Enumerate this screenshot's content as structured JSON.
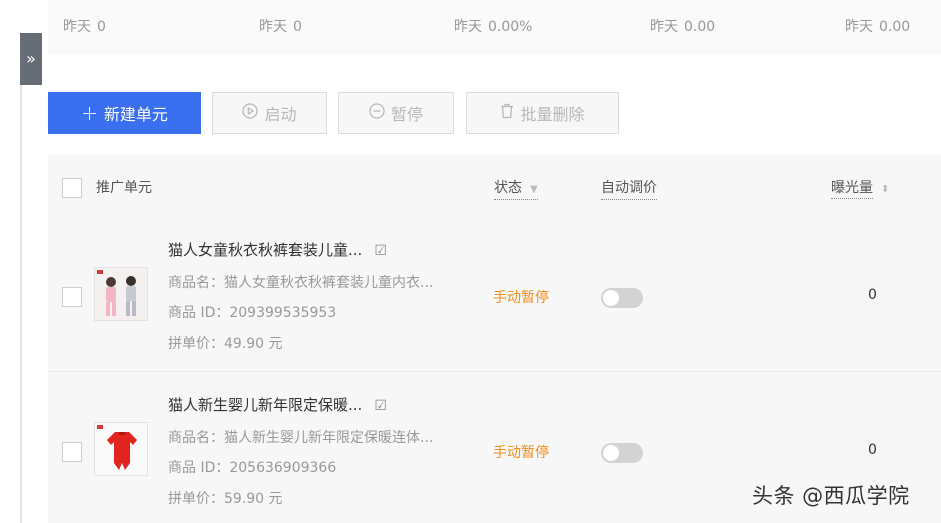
{
  "stats_strip": [
    {
      "label": "昨天",
      "value": "0"
    },
    {
      "label": "昨天",
      "value": "0"
    },
    {
      "label": "昨天",
      "value": "0.00%"
    },
    {
      "label": "昨天",
      "value": "0.00"
    },
    {
      "label": "昨天",
      "value": "0.00"
    }
  ],
  "sidebar_toggle": "»",
  "toolbar": {
    "new_unit": "新建单元",
    "start": "启动",
    "pause": "暂停",
    "batch_delete": "批量删除"
  },
  "table": {
    "headers": {
      "unit": "推广单元",
      "status": "状态",
      "auto_bid": "自动调价",
      "exposure": "曝光量"
    },
    "rows": [
      {
        "name": "猫人女童秋衣秋裤套装儿童...",
        "product_name": "商品名：猫人女童秋衣秋裤套装儿童内衣...",
        "product_id": "商品 ID：209399535953",
        "price": "拼单价：49.90 元",
        "status": "手动暂停",
        "auto_bid_on": false,
        "exposure": "0",
        "thumb_icon": "kids-pajamas-icon"
      },
      {
        "name": "猫人新生婴儿新年限定保暖...",
        "product_name": "商品名：猫人新生婴儿新年限定保暖连体...",
        "product_id": "商品 ID：205636909366",
        "price": "拼单价：59.90 元",
        "status": "手动暂停",
        "auto_bid_on": false,
        "exposure": "0",
        "thumb_icon": "baby-romper-icon"
      }
    ]
  },
  "watermark": "头条 @西瓜学院",
  "colors": {
    "primary": "#3a6ff0",
    "status_paused": "#f28d1b",
    "toggle_off": "#d3d3d3"
  }
}
